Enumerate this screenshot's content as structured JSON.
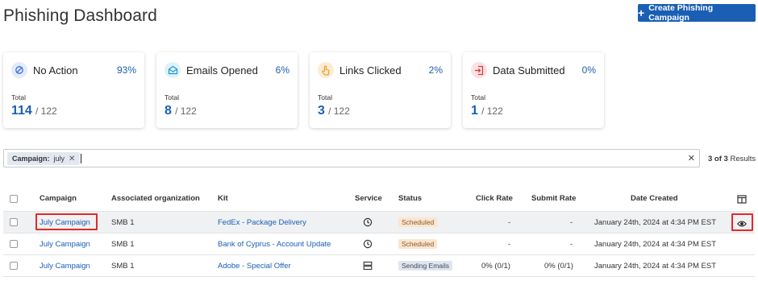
{
  "header": {
    "title": "Phishing Dashboard",
    "create_button": "Create Phishing Campaign"
  },
  "cards": [
    {
      "label": "No Action",
      "pct": "93%",
      "total_label": "Total",
      "total": "114",
      "of": "/ 122",
      "icon": "no-action-icon",
      "color": "#3b6fd8"
    },
    {
      "label": "Emails Opened",
      "pct": "6%",
      "total_label": "Total",
      "total": "8",
      "of": "/ 122",
      "icon": "envelope-open-icon",
      "color": "#1c9bc9"
    },
    {
      "label": "Links Clicked",
      "pct": "2%",
      "total_label": "Total",
      "total": "3",
      "of": "/ 122",
      "icon": "pointer-hand-icon",
      "color": "#e79a27"
    },
    {
      "label": "Data Submitted",
      "pct": "0%",
      "total_label": "Total",
      "total": "1",
      "of": "/ 122",
      "icon": "submit-icon",
      "color": "#d63a3a"
    }
  ],
  "filter": {
    "chip_key": "Campaign:",
    "chip_value": "july",
    "results": "3 of 3",
    "results_suffix": "Results"
  },
  "table": {
    "columns": [
      "Campaign",
      "Associated organization",
      "Kit",
      "Service",
      "Status",
      "Click Rate",
      "Submit Rate",
      "Date Created"
    ],
    "rows": [
      {
        "campaign": "July Campaign",
        "org": "SMB 1",
        "kit": "FedEx - Package Delivery",
        "service_icon": "clock-icon",
        "status": "Scheduled",
        "click_rate": "-",
        "submit_rate": "-",
        "date": "January 24th, 2024 at 4:34 PM EST"
      },
      {
        "campaign": "July Campaign",
        "org": "SMB 1",
        "kit": "Bank of Cyprus - Account Update",
        "service_icon": "clock-icon",
        "status": "Scheduled",
        "click_rate": "-",
        "submit_rate": "-",
        "date": "January 24th, 2024 at 4:34 PM EST"
      },
      {
        "campaign": "July Campaign",
        "org": "SMB 1",
        "kit": "Adobe - Special Offer",
        "service_icon": "server-icon",
        "status": "Sending Emails",
        "click_rate": "0% (0/1)",
        "submit_rate": "0% (0/1)",
        "date": "January 24th, 2024 at 4:34 PM EST"
      }
    ]
  }
}
